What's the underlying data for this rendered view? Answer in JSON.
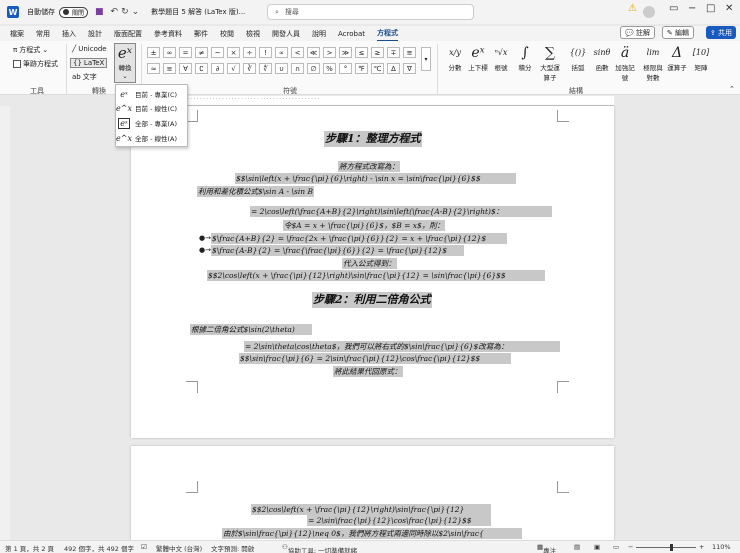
{
  "titlebar": {
    "autosave": "自動儲存",
    "toggle": "關閉",
    "doc_title": "數學題目 5 解答 (LaTex 版)...",
    "search_placeholder": "搜尋"
  },
  "tabs": [
    "檔案",
    "常用",
    "插入",
    "設計",
    "版面配置",
    "參考資料",
    "郵件",
    "校閱",
    "檢視",
    "開發人員",
    "說明",
    "Acrobat",
    "方程式"
  ],
  "active_tab": "方程式",
  "top_buttons": {
    "comment": "註解",
    "edit": "編輯",
    "share": "共用"
  },
  "ribbon": {
    "tools": {
      "equation": "方程式",
      "ink": "筆跡方程式",
      "label": "工具"
    },
    "convert": {
      "unicode": "Unicode",
      "latex": "LaTeX",
      "text": "文字",
      "convert_btn": "轉換",
      "label": "轉換"
    },
    "symbols": {
      "label": "符號",
      "row1": [
        "±",
        "∞",
        "=",
        "≠",
        "~",
        "×",
        "÷",
        "!",
        "∝",
        "<",
        "≪",
        ">",
        "≫",
        "≤",
        "≥",
        "∓",
        "≅"
      ],
      "row2": [
        "≈",
        "≡",
        "∀",
        "∁",
        "∂",
        "√",
        "∛",
        "∜",
        "∪",
        "∩",
        "∅",
        "%",
        "°",
        "℉",
        "℃",
        "∆",
        "∇"
      ]
    },
    "structures": {
      "label": "結構",
      "items": [
        {
          "glyph": "x/y",
          "label": "分數"
        },
        {
          "glyph": "eˣ",
          "label": "上下標"
        },
        {
          "glyph": "ⁿ√x",
          "label": "根號"
        },
        {
          "glyph": "∫",
          "label": "積分"
        },
        {
          "glyph": "∑",
          "label": "大型運算子"
        },
        {
          "glyph": "{()}",
          "label": "括弧"
        },
        {
          "glyph": "sinθ",
          "label": "函數"
        },
        {
          "glyph": "ä",
          "label": "加強記號"
        },
        {
          "glyph": "lim",
          "label": "極限與對數"
        },
        {
          "glyph": "Δ",
          "label": "運算子"
        },
        {
          "glyph": "[10]",
          "label": "矩陣"
        }
      ]
    }
  },
  "dropdown": [
    {
      "label": "目前 - 專業(C)",
      "selected": false
    },
    {
      "label": "目前 - 線性(C)",
      "selected": false
    },
    {
      "label": "全部 - 專業(A)",
      "selected": true
    },
    {
      "label": "全部 - 線性(A)",
      "selected": false
    }
  ],
  "page1": {
    "heading1": "步驟1：整理方程式",
    "l1": "將方程式改寫為：",
    "l2": "$$\\sin\\left(x + \\frac{\\pi}{6}\\right) - \\sin x = \\sin\\frac{\\pi}{6}$$",
    "l3": "利用和差化積公式$\\sin A - \\sin B",
    "l4": "= 2\\cos\\left(\\frac{A+B}{2}\\right)\\sin\\left(\\frac{A-B}{2}\\right)$：",
    "l5": "令$A = x + \\frac{\\pi}{6}$，$B = x$，則：",
    "l6": "$\\frac{A+B}{2} = \\frac{2x + \\frac{\\pi}{6}}{2} = x + \\frac{\\pi}{12}$",
    "l7": "$\\frac{A-B}{2} = \\frac{\\frac{\\pi}{6}}{2} = \\frac{\\pi}{12}$",
    "l8": "代入公式得到：",
    "l9": "$$2\\cos\\left(x + \\frac{\\pi}{12}\\right)\\sin\\frac{\\pi}{12} = \\sin\\frac{\\pi}{6}$$",
    "heading2": "步驟2：利用二倍角公式",
    "l10": "根據二倍角公式$\\sin(2\\theta)",
    "l11": "= 2\\sin\\theta\\cos\\theta$，我們可以將右式的$\\sin\\frac{\\pi}{6}$改寫為：",
    "l12": "$$\\sin\\frac{\\pi}{6} = 2\\sin\\frac{\\pi}{12}\\cos\\frac{\\pi}{12}$$",
    "l13": "將此結果代回原式："
  },
  "page2": {
    "l1": "$$2\\cos\\left(x + \\frac{\\pi}{12}\\right)\\sin\\frac{\\pi}{12}",
    "l2": "= 2\\sin\\frac{\\pi}{12}\\cos\\frac{\\pi}{12}$$",
    "l3": "由於$\\sin\\frac{\\pi}{12}\\neq 0$，我們將方程式兩邊同時除以$2\\sin\\frac{"
  },
  "status": {
    "page": "第 1 頁，共 2 頁",
    "words": "492 個字，共 492 個字",
    "lang": "繁體中文 (台灣)",
    "predict": "文字預測: 開啟",
    "access": "協助工具: 一切準備就緒",
    "focus": "專注",
    "zoom": "110%"
  }
}
